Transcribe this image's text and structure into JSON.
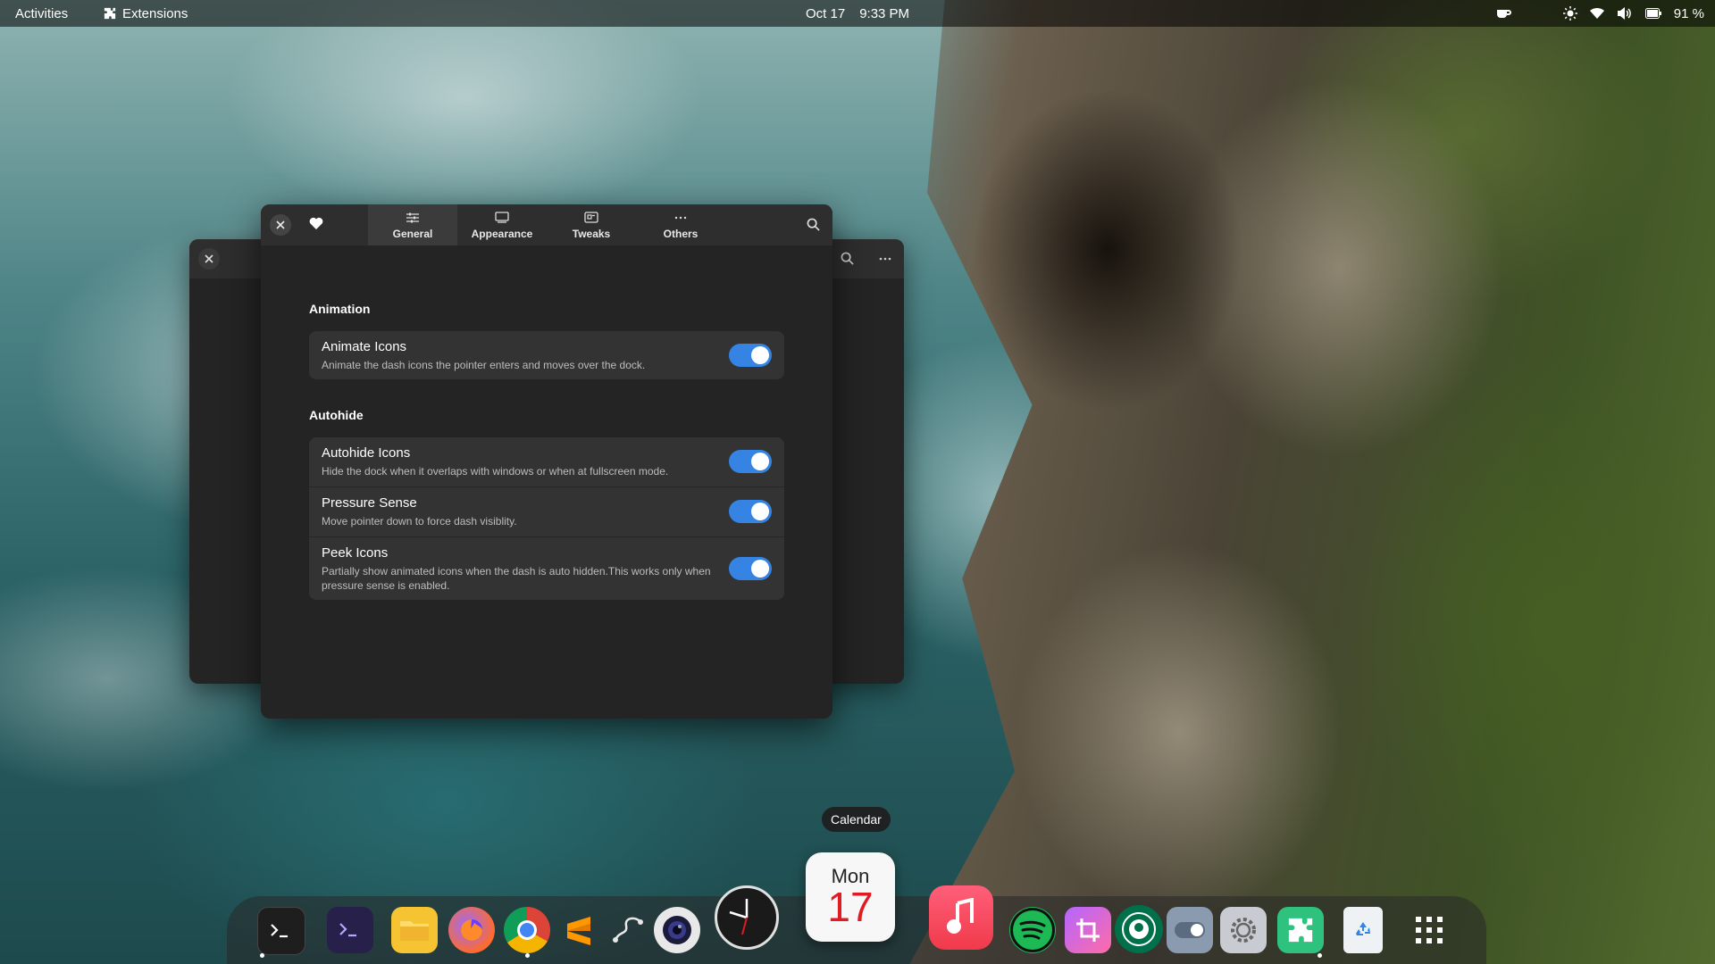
{
  "topbar": {
    "activities": "Activities",
    "extensions": "Extensions",
    "date": "Oct 17",
    "time": "9:33 PM",
    "battery": "91 %",
    "tray_icons": [
      "coffee-icon",
      "brightness-icon",
      "wifi-icon",
      "volume-icon",
      "battery-icon"
    ]
  },
  "main_window": {
    "tabs": [
      {
        "label": "General",
        "icon": "sliders-icon",
        "active": true
      },
      {
        "label": "Appearance",
        "icon": "monitor-icon",
        "active": false
      },
      {
        "label": "Tweaks",
        "icon": "tweaks-icon",
        "active": false
      },
      {
        "label": "Others",
        "icon": "more-icon",
        "active": false
      }
    ],
    "sections": [
      {
        "title": "Animation",
        "rows": [
          {
            "title": "Animate Icons",
            "subtitle": "Animate the dash icons the pointer enters and moves over the dock.",
            "enabled": true
          }
        ]
      },
      {
        "title": "Autohide",
        "rows": [
          {
            "title": "Autohide Icons",
            "subtitle": "Hide the dock when it overlaps with windows or when at fullscreen mode.",
            "enabled": true
          },
          {
            "title": "Pressure Sense",
            "subtitle": "Move pointer down to force dash visiblity.",
            "enabled": true
          },
          {
            "title": "Peek Icons",
            "subtitle": "Partially show animated icons when the dash is auto hidden.This works only when pressure sense is enabled.",
            "enabled": true
          }
        ]
      }
    ]
  },
  "dock": {
    "tooltip": "Calendar",
    "calendar": {
      "day": "Mon",
      "date": "17"
    },
    "apps": [
      "terminal",
      "terminal-alt",
      "files",
      "firefox",
      "chrome",
      "sublime-text",
      "inkscape",
      "camera",
      "clock",
      "calendar",
      "music",
      "spotify",
      "crop",
      "starbucks",
      "toggle-settings",
      "settings",
      "extensions",
      "trash",
      "app-grid"
    ]
  },
  "colors": {
    "accent": "#3584e4",
    "window_bg": "#242424",
    "card_bg": "#333333",
    "header_bg": "#2e2e2e"
  }
}
